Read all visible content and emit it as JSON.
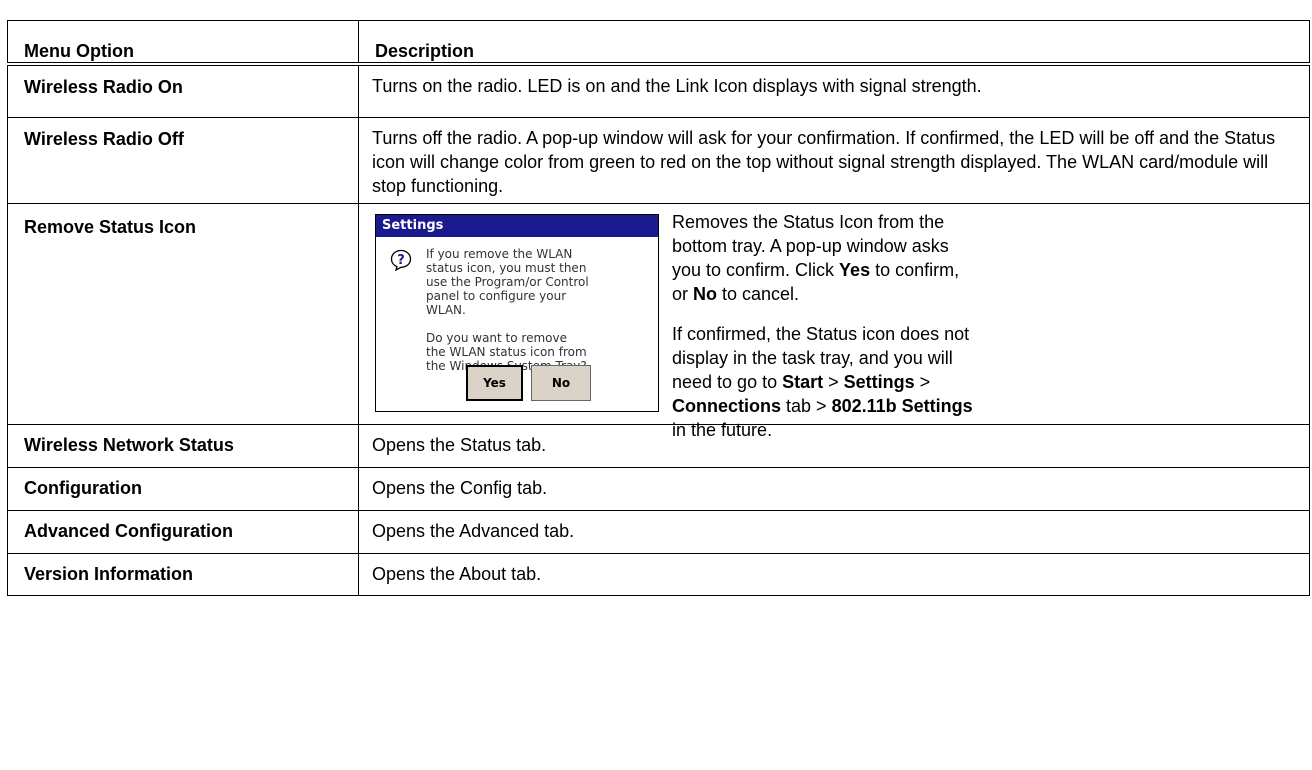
{
  "header": {
    "col1": "Menu Option",
    "col2": "Description"
  },
  "rows": [
    {
      "option": "Wireless Radio On",
      "desc": "Turns on the radio. LED is on and the Link Icon displays with signal strength."
    },
    {
      "option": "Wireless Radio Off",
      "desc": "Turns off the radio. A pop-up window will ask for your confirmation. If confirmed, the LED will be off and the Status icon will change color from green to red on the top without signal strength displayed. The WLAN card/module will stop functioning."
    },
    {
      "option": "Remove Status Icon"
    },
    {
      "option": "Wireless Network Status",
      "desc": "Opens the Status tab."
    },
    {
      "option": "Configuration",
      "desc": "Opens the Config tab."
    },
    {
      "option": "Advanced Configuration",
      "desc": "Opens the Advanced tab."
    },
    {
      "option": "Version Information",
      "desc": "Opens the About tab."
    }
  ],
  "remove": {
    "dialog": {
      "title": "Settings",
      "message": "If you remove the WLAN\nstatus icon, you must then\nuse the Program/or Control\npanel to configure your\nWLAN.\n\nDo you want to remove\nthe WLAN status icon from\nthe Windows System Tray?",
      "yes": "Yes",
      "no": "No",
      "icon": "question-icon"
    },
    "p1": {
      "t1": "Removes the Status Icon from the bottom tray. A pop-up window asks you to confirm. Click ",
      "b1": "Yes",
      "t2": " to confirm, or ",
      "b2": "No",
      "t3": " to cancel."
    },
    "p2": {
      "t1": "If confirmed, the Status icon does not display in the task tray, and you will need to go to ",
      "b1": "Start",
      "t2": " > ",
      "b2": "Settings",
      "t3": " > ",
      "b3": "Connections",
      "t4": " tab > ",
      "b4": "802.11b Settings",
      "t5": " in the future."
    }
  },
  "colors": {
    "dialog_title_bg": "#1a1a8f",
    "button_bg": "#dcd3c8"
  }
}
